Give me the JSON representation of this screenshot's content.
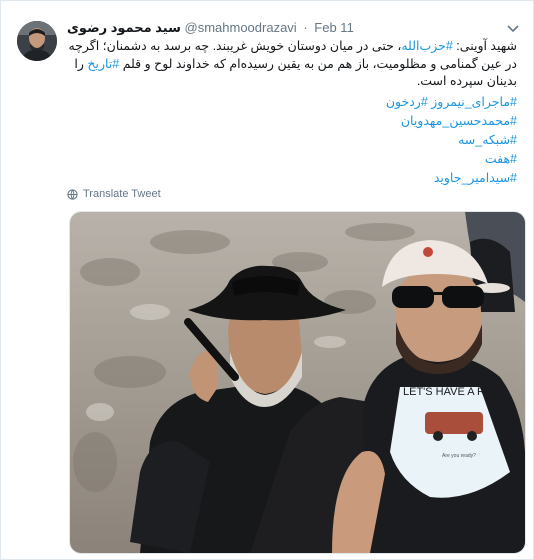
{
  "tweet": {
    "display_name": "سید محمود رضوی",
    "handle": "@smahmoodrazavi",
    "separator": "·",
    "date": "Feb 11",
    "text_line1_a": "شهید آوینی: ",
    "text_hashtag1": "#حزب‌الله",
    "text_line1_b": "، حتی در میان دوستان خویش غریبند. چه برسد به دشمنان؛ اگرچه",
    "text_line2": "در عین گمنامی و مظلومیت، باز هم من به یقین رسیده‌ام که خداوند لوح و قلم ",
    "text_hashtag2": "#تاریخ",
    "text_line2_b": " را",
    "text_line3": "بدینان سپرده است.",
    "hashtag_line1": "#ماجرای_نیمروز  #ردخون",
    "hashtag_line2": "#محمدحسین_مهدویان",
    "hashtag_line3": "#شبکه_سه",
    "hashtag_line4": "#هفت",
    "hashtag_line5": "#سیدامیر_جاوید",
    "translate_label": "Translate Tweet",
    "photo_shirt_text": "LET'S HAVE A RIDE",
    "photo_shirt_small": "Are you ready?"
  },
  "colors": {
    "link": "#1b95e0",
    "secondary_text": "#657786",
    "primary_text": "#14171a"
  },
  "icons": {
    "globe": "globe-icon",
    "caret": "chevron-down-icon"
  }
}
